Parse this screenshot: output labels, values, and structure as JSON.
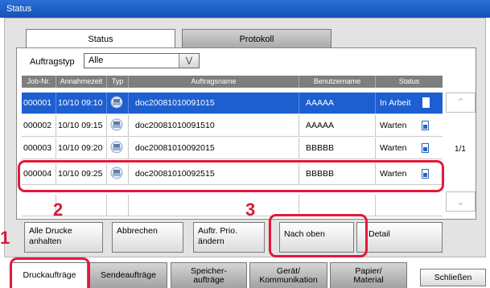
{
  "window": {
    "title": "Status"
  },
  "tabs": [
    {
      "label": "Status"
    },
    {
      "label": "Protokoll"
    }
  ],
  "filter": {
    "label": "Auftragstyp",
    "value": "Alle"
  },
  "table": {
    "headers": [
      "Job-Nr.",
      "Annahmezeit",
      "Typ",
      "Auftragsname",
      "Benutzername",
      "Status"
    ],
    "rows": [
      {
        "job": "000001",
        "time": "10/10 09:10",
        "name": "doc20081010091015",
        "user": "AAAAA",
        "status": "In Arbeit",
        "icon": "print-job-icon",
        "status_icon": "working-icon",
        "selected": true
      },
      {
        "job": "000002",
        "time": "10/10 09:15",
        "name": "doc20081010091510",
        "user": "AAAAA",
        "status": "Warten",
        "icon": "print-job-icon",
        "status_icon": "waiting-icon",
        "selected": false
      },
      {
        "job": "000003",
        "time": "10/10 09:20",
        "name": "doc20081010092015",
        "user": "BBBBB",
        "status": "Warten",
        "icon": "print-job-icon",
        "status_icon": "waiting-icon",
        "selected": false
      },
      {
        "job": "000004",
        "time": "10/10 09:25",
        "name": "doc20081010092515",
        "user": "BBBBB",
        "status": "Warten",
        "icon": "print-job-icon",
        "status_icon": "waiting-icon",
        "selected": false
      }
    ]
  },
  "pagination": {
    "page": "1/1"
  },
  "actions": {
    "pause_all": "Alle Drucke anhalten",
    "cancel": "Abbrechen",
    "priority": "Auftr. Prio. ändern",
    "move_up": "Nach oben",
    "detail": "Detail"
  },
  "callouts": [
    "1",
    "2",
    "3"
  ],
  "bottom_tabs": [
    {
      "label": "Druckaufträge"
    },
    {
      "label": "Sendeaufträge"
    },
    {
      "label": "Speicher-\naufträge"
    },
    {
      "label": "Gerät/\nKommunikation"
    },
    {
      "label": "Papier/\nMaterial"
    }
  ],
  "close_label": "Schließen",
  "colors": {
    "title_bar": "#1a5fc8",
    "selection": "#1d5fd0",
    "highlight": "#e4183a"
  }
}
